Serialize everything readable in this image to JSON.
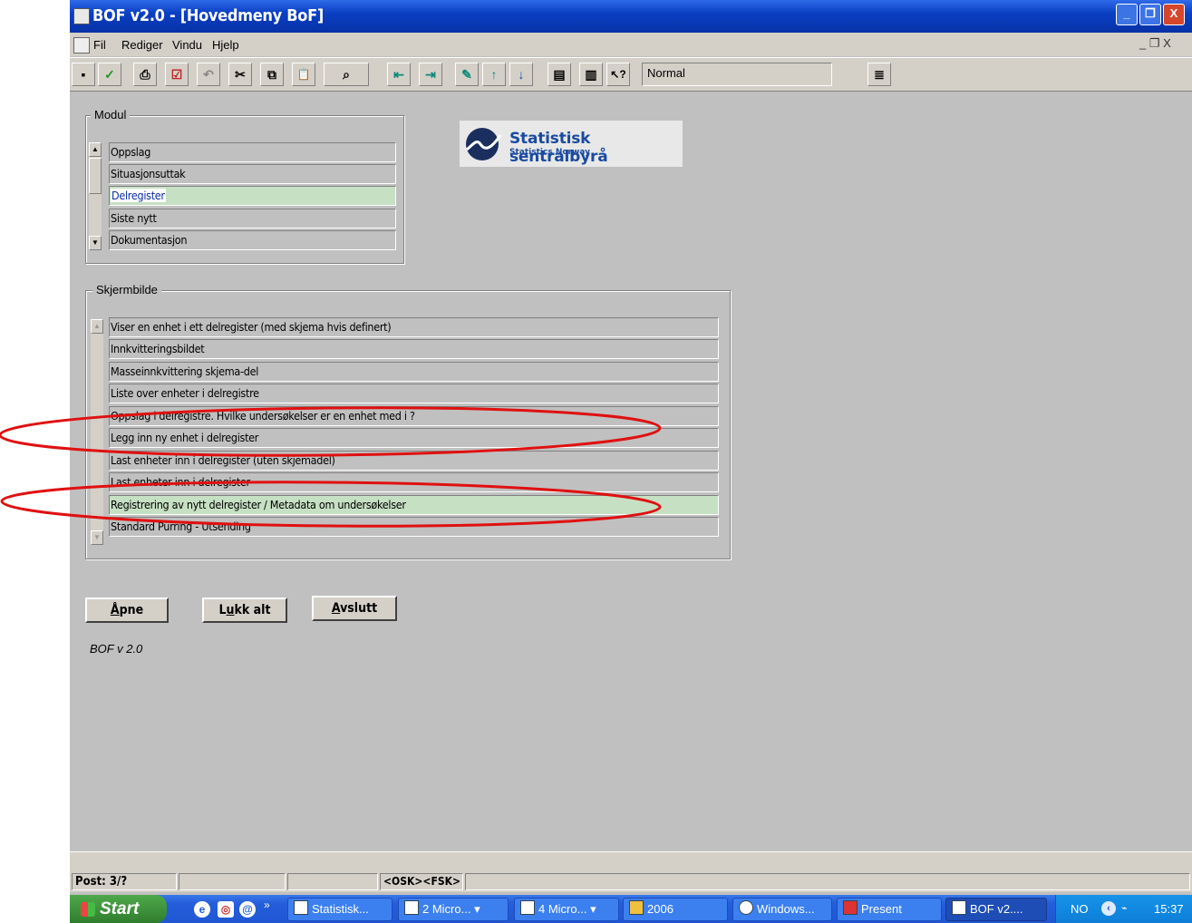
{
  "window": {
    "title": "BOF v2.0 - [Hovedmeny BoF]",
    "controls": {
      "minimize": "_",
      "restore": "❐",
      "close": "X"
    }
  },
  "menu": {
    "items": [
      "Fil",
      "Rediger",
      "Vindu",
      "Hjelp"
    ],
    "mdi_controls": "_ ❐ X"
  },
  "toolbar": {
    "style_value": "Normal",
    "buttons": [
      {
        "name": "save-icon",
        "glyph": "▪"
      },
      {
        "name": "check-icon",
        "glyph": "✓"
      },
      {
        "name": "print-icon",
        "glyph": "⎙"
      },
      {
        "name": "form-icon",
        "glyph": "☑"
      },
      {
        "name": "undo-icon",
        "glyph": "↶"
      },
      {
        "name": "cut-icon",
        "glyph": "✂"
      },
      {
        "name": "copy-icon",
        "glyph": "⧉"
      },
      {
        "name": "paste-icon",
        "glyph": "📋"
      },
      {
        "name": "query-icon",
        "glyph": "⌕"
      },
      {
        "name": "insert-record-icon",
        "glyph": "⇤"
      },
      {
        "name": "delete-record-icon",
        "glyph": "⇥"
      },
      {
        "name": "edit-icon",
        "glyph": "✎"
      },
      {
        "name": "arrow-up-icon",
        "glyph": "↑"
      },
      {
        "name": "arrow-down-icon",
        "glyph": "↓"
      },
      {
        "name": "list-icon",
        "glyph": "▤"
      },
      {
        "name": "book-icon",
        "glyph": "▥"
      },
      {
        "name": "help-pointer-icon",
        "glyph": "↖?"
      },
      {
        "name": "document-icon",
        "glyph": "≣"
      }
    ]
  },
  "logo": {
    "title": "Statistisk sentralbyrå",
    "subtitle": "Statistics Norway"
  },
  "modul": {
    "label": "Modul",
    "items": [
      "Oppslag",
      "Situasjonsuttak",
      "Delregister",
      "Siste nytt",
      "Dokumentasjon"
    ],
    "selected_index": 2
  },
  "skjermbilde": {
    "label": "Skjermbilde",
    "items": [
      "Viser en enhet i ett delregister (med skjema hvis definert)",
      "Innkvitteringsbildet",
      "Masseinnkvittering skjema-del",
      "Liste over enheter i delregistre",
      "Oppslag i delregistre.  Hvilke undersøkelser er en enhet med i ?",
      "Legg inn ny enhet i delregister",
      "Last enheter inn i delregister (uten  skjemadel)",
      "Last enheter inn i delregister",
      "Registrering av nytt delregister / Metadata om undersøkelser",
      "Standard Purring - Utsending"
    ],
    "highlighted_index": 8,
    "circled_indices": [
      5,
      8
    ],
    "annotation_color": "#e01010"
  },
  "buttons": {
    "open": {
      "pre": "",
      "accel": "Å",
      "post": "pne"
    },
    "close_all": {
      "pre": "L",
      "accel": "u",
      "post": "kk alt"
    },
    "exit": {
      "pre": "",
      "accel": "A",
      "post": "vslutt"
    }
  },
  "version_text": "BOF v 2.0",
  "status": {
    "post": "Post: 3/?",
    "mode": "<OSK><FSK>"
  },
  "taskbar": {
    "start": "Start",
    "chevron": "»",
    "tasks": [
      {
        "label": "Statistisk...",
        "active": false
      },
      {
        "label": "2 Micro...",
        "active": false
      },
      {
        "label": "4 Micro...",
        "active": false
      },
      {
        "label": "2006",
        "active": false
      },
      {
        "label": "Windows...",
        "active": false
      },
      {
        "label": "Present",
        "active": false
      },
      {
        "label": "BOF v2....",
        "active": true
      }
    ],
    "lang": "NO",
    "clock": "15:37"
  }
}
